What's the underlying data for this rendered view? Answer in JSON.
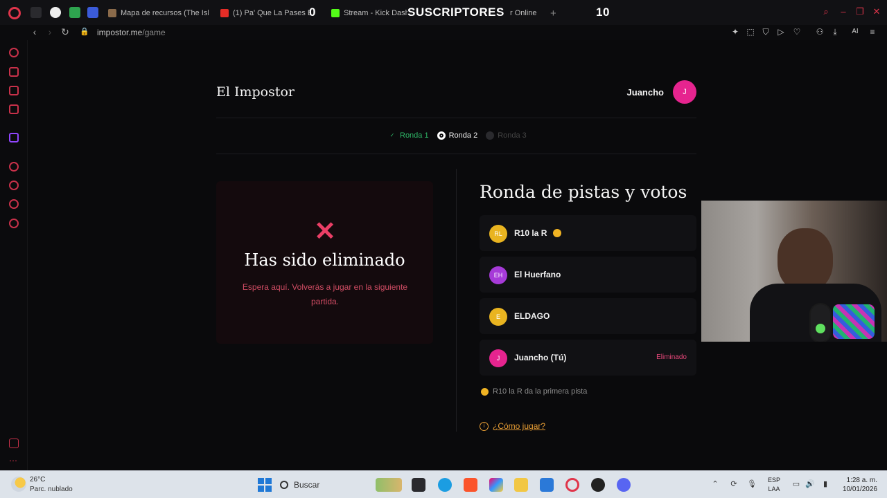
{
  "browser": {
    "tabs": [
      {
        "label": "Mapa de recursos (The Isl"
      },
      {
        "label": "(1) Pa' Que La Pases Bi"
      },
      {
        "label": "Stream - Kick Dashb"
      },
      {
        "label": "r Online"
      }
    ],
    "overlay": {
      "left_value": "0",
      "label": "SUSCRIPTORES",
      "right_value": "10"
    },
    "url_host": "impostor.me",
    "url_path": "/game",
    "new_tab": "+",
    "ai_label": "AI"
  },
  "app": {
    "title": "El Impostor",
    "user": {
      "name": "Juancho",
      "initial": "J"
    }
  },
  "rounds": [
    {
      "label": "Ronda 1",
      "state": "done"
    },
    {
      "label": "Ronda 2",
      "state": "current"
    },
    {
      "label": "Ronda 3",
      "state": "future"
    }
  ],
  "eliminated": {
    "title": "Has sido eliminado",
    "subtitle": "Espera aquí. Volverás a jugar en la siguiente partida."
  },
  "panel": {
    "title": "Ronda de pistas y votos",
    "players": [
      {
        "initials": "RL",
        "name": "R10 la R",
        "color": "#e9b420",
        "has_turn": true,
        "status": ""
      },
      {
        "initials": "EH",
        "name": "El Huerfano",
        "color": "#a63ad8",
        "has_turn": false,
        "status": ""
      },
      {
        "initials": "E",
        "name": "ELDAGO",
        "color": "#e9b420",
        "has_turn": false,
        "status": ""
      },
      {
        "initials": "J",
        "name": "Juancho (Tú)",
        "color": "#e6248f",
        "has_turn": false,
        "status": "Eliminado"
      }
    ],
    "hint": "R10 la R da la primera pista",
    "how_to_play": "¿Cómo jugar?"
  },
  "taskbar": {
    "temperature": "26°C",
    "weather": "Parc. nublado",
    "search": "Buscar",
    "lang_top": "ESP",
    "lang_bottom": "LAA",
    "time": "1:28 a. m.",
    "date": "10/01/2026"
  },
  "colors": {
    "accent_red": "#e0354b",
    "avatar_pink": "#e6248f",
    "eliminated_red": "#ea3f66",
    "done_green": "#2fb868",
    "link_orange": "#ea9f35"
  }
}
